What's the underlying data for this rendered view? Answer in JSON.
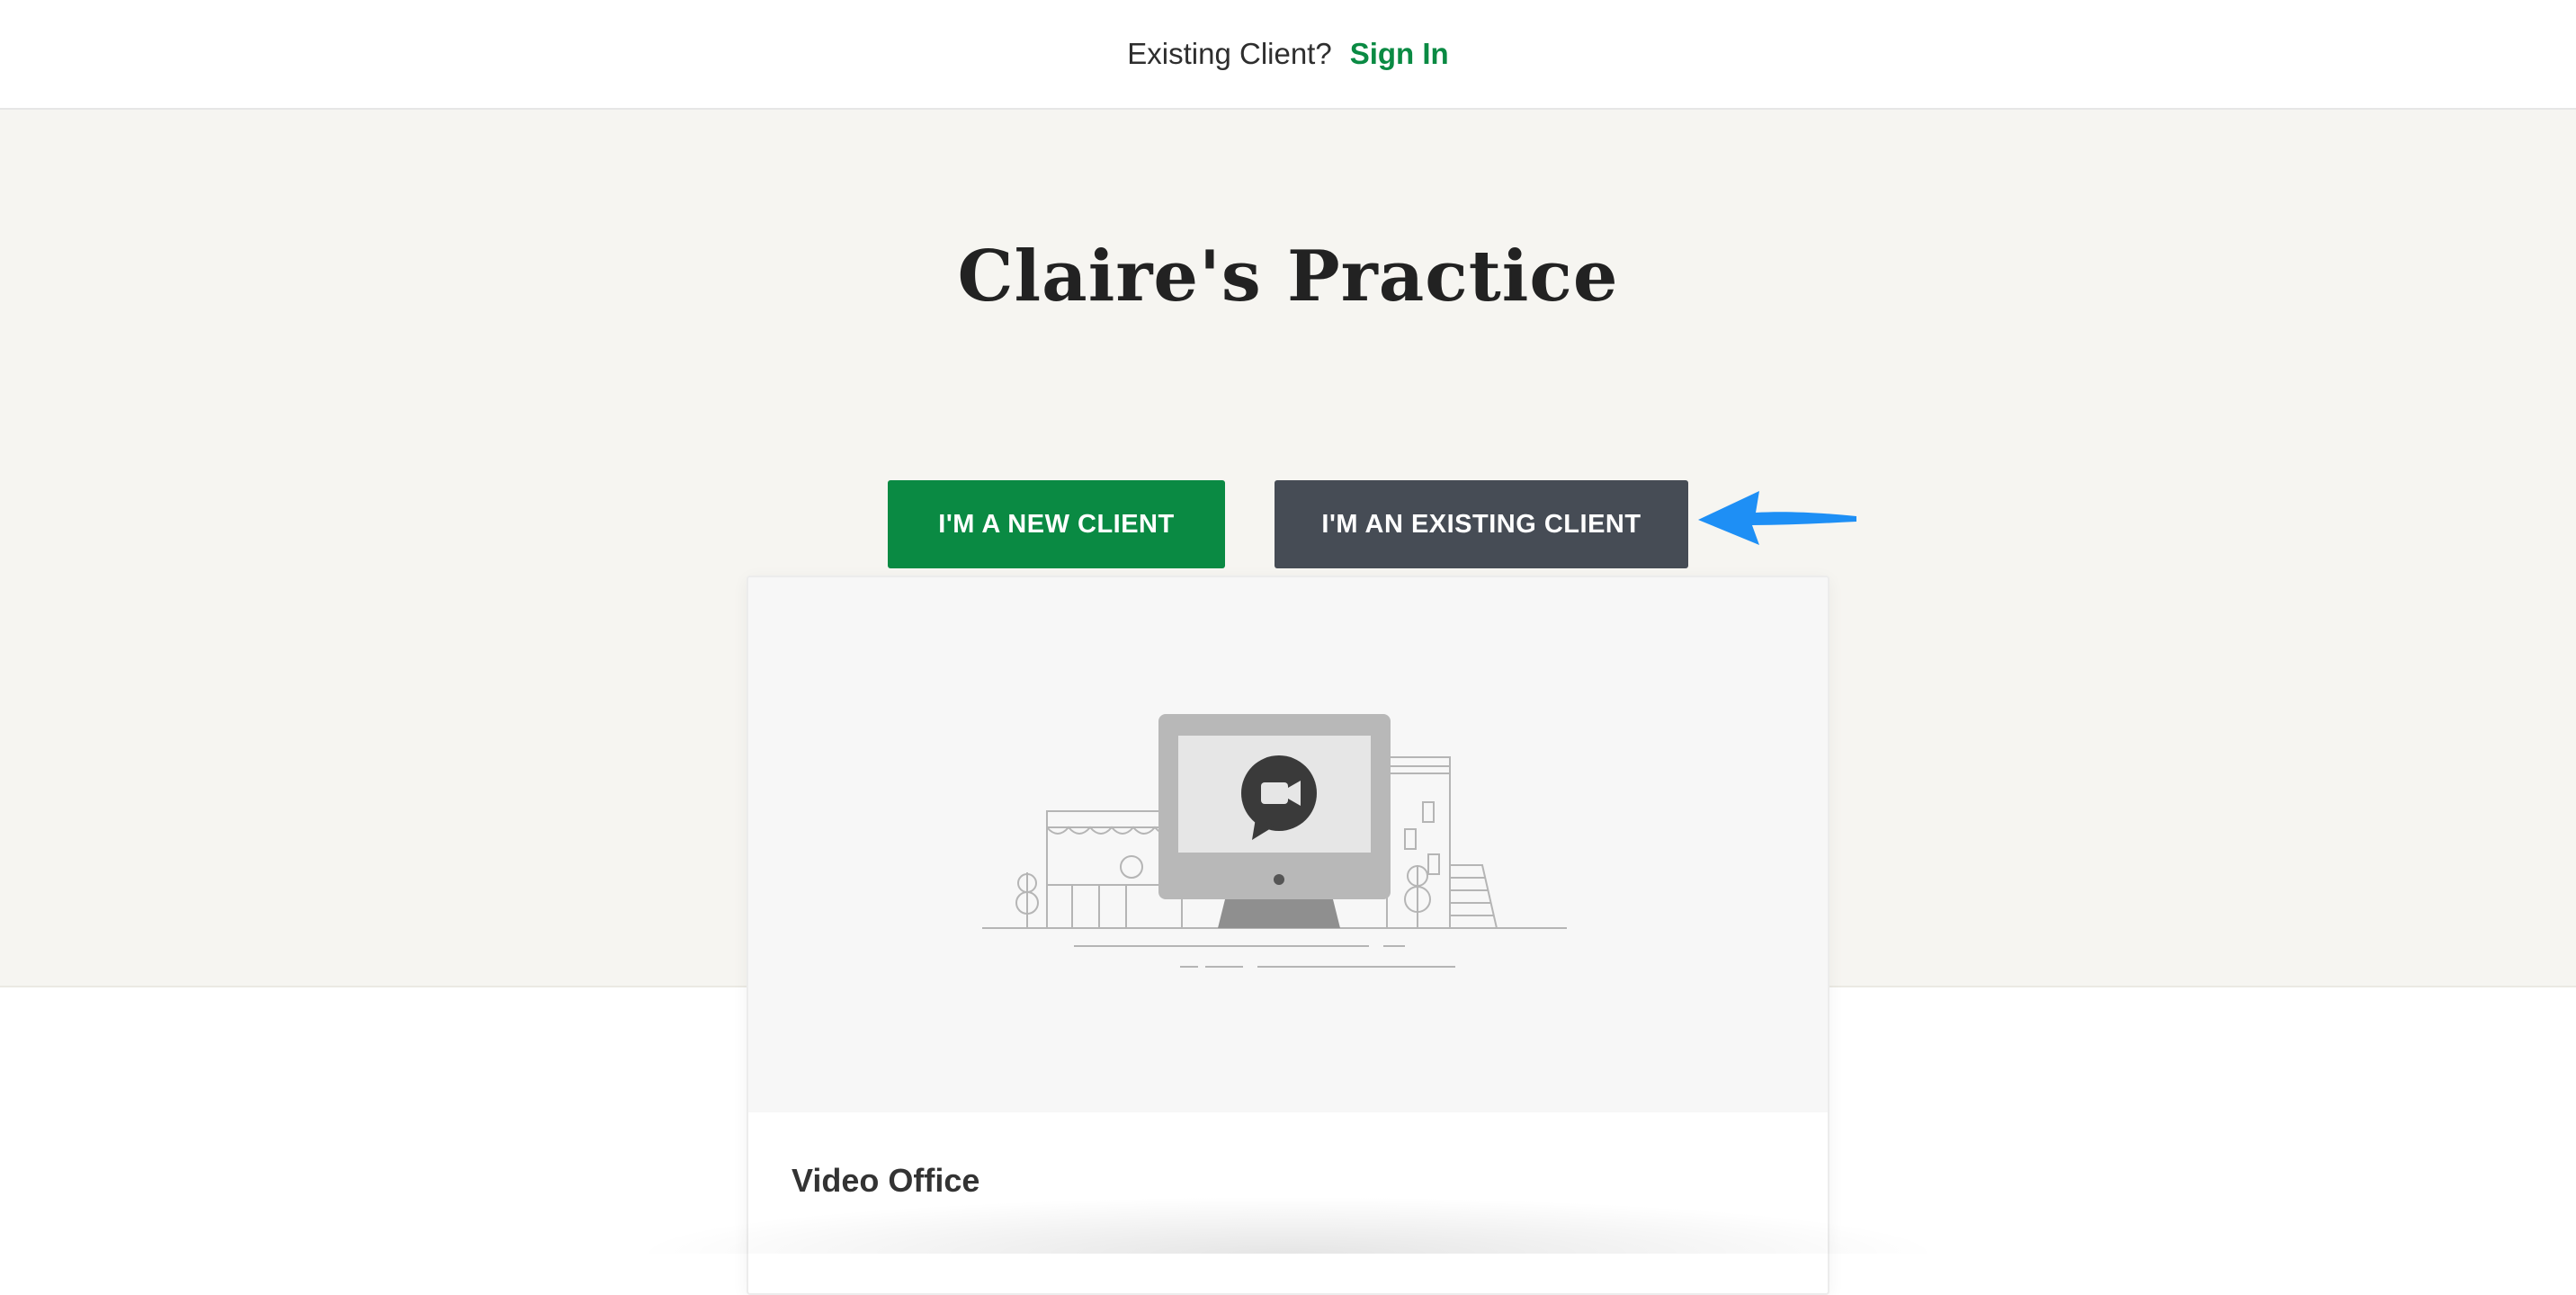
{
  "header": {
    "prompt": "Existing Client?",
    "signin_label": "Sign In"
  },
  "practice": {
    "title": "Claire's Practice"
  },
  "actions": {
    "new_client_label": "I'M A NEW CLIENT",
    "existing_client_label": "I'M AN EXISTING CLIENT"
  },
  "card": {
    "title": "Video Office",
    "illustration_icon": "video-chat-icon"
  },
  "colors": {
    "brand_green": "#0a8a43",
    "button_dark": "#464c55",
    "hero_background": "#f6f5f1",
    "annotation_arrow": "#1e8ff5"
  }
}
